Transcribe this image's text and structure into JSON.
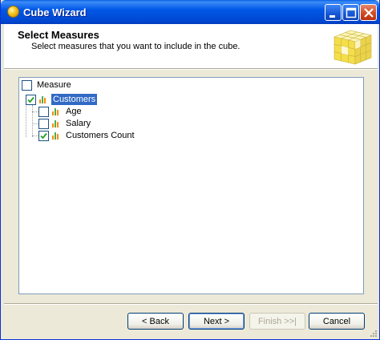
{
  "window": {
    "title": "Cube Wizard"
  },
  "header": {
    "title": "Select Measures",
    "subtitle": "Select measures that you want to include in the cube."
  },
  "tree": {
    "root": {
      "label": "Measure",
      "checked": false
    },
    "group": {
      "label": "Customers",
      "checked": true,
      "selected": true
    },
    "items": [
      {
        "label": "Age",
        "checked": false
      },
      {
        "label": "Salary",
        "checked": false
      },
      {
        "label": "Customers Count",
        "checked": true
      }
    ]
  },
  "buttons": {
    "back": "< Back",
    "next": "Next >",
    "finish": "Finish >>|",
    "cancel": "Cancel"
  },
  "colors": {
    "selection": "#316ac5",
    "measure_icon": [
      "#ff8c00",
      "#4caf50",
      "#ff8c00"
    ]
  }
}
